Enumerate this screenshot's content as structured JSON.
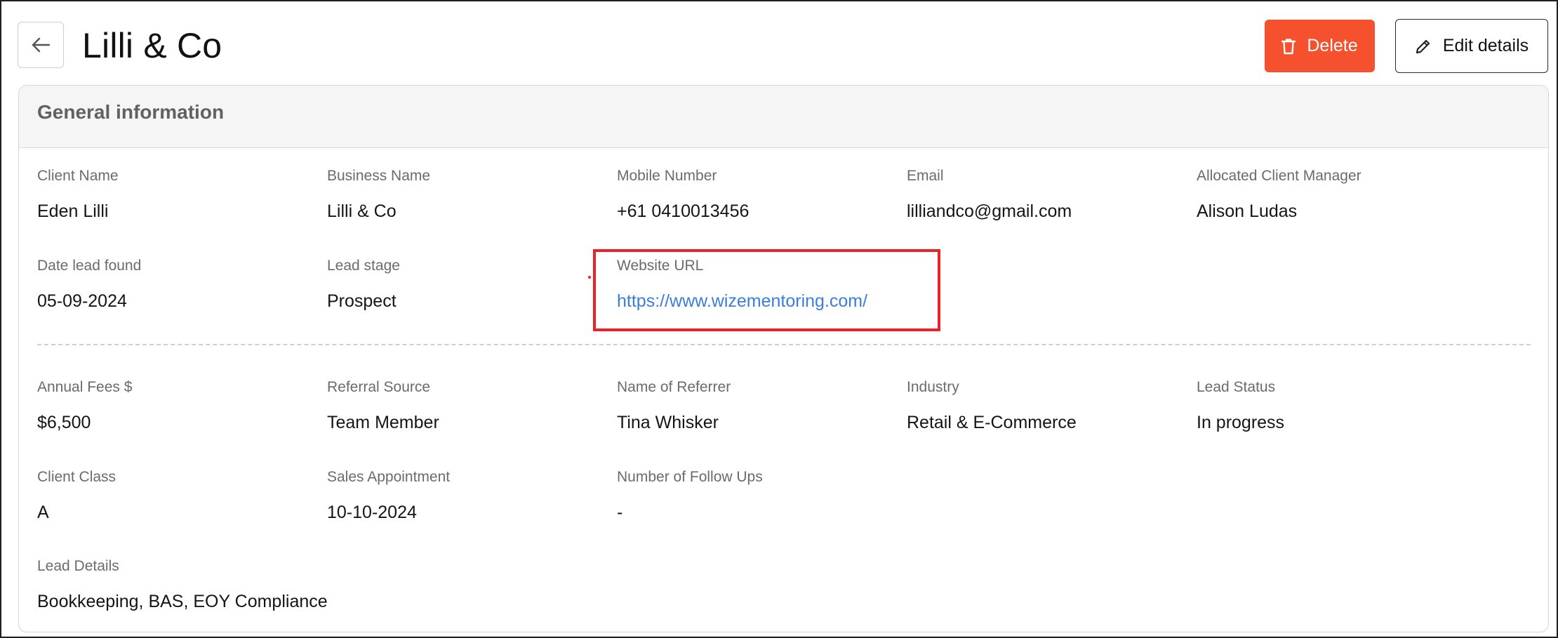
{
  "header": {
    "title": "Lilli & Co",
    "delete_label": "Delete",
    "edit_label": "Edit details"
  },
  "section": {
    "title": "General information"
  },
  "fields": {
    "client_name": {
      "label": "Client Name",
      "value": "Eden Lilli"
    },
    "business_name": {
      "label": "Business Name",
      "value": "Lilli & Co"
    },
    "mobile_number": {
      "label": "Mobile Number",
      "value": "+61 0410013456"
    },
    "email": {
      "label": "Email",
      "value": "lilliandco@gmail.com"
    },
    "allocated_client_manager": {
      "label": "Allocated Client Manager",
      "value": "Alison Ludas"
    },
    "date_lead_found": {
      "label": "Date lead found",
      "value": "05-09-2024"
    },
    "lead_stage": {
      "label": "Lead stage",
      "value": "Prospect"
    },
    "website_url": {
      "label": "Website URL",
      "value": "https://www.wizementoring.com/"
    },
    "annual_fees": {
      "label": "Annual Fees $",
      "value": "$6,500"
    },
    "referral_source": {
      "label": "Referral Source",
      "value": "Team Member"
    },
    "name_of_referrer": {
      "label": "Name of Referrer",
      "value": "Tina Whisker"
    },
    "industry": {
      "label": "Industry",
      "value": "Retail & E-Commerce"
    },
    "lead_status": {
      "label": "Lead Status",
      "value": "In progress"
    },
    "client_class": {
      "label": "Client Class",
      "value": "A"
    },
    "sales_appointment": {
      "label": "Sales Appointment",
      "value": "10-10-2024"
    },
    "number_of_follow_ups": {
      "label": "Number of Follow Ups",
      "value": "-"
    },
    "lead_details": {
      "label": "Lead Details",
      "value": "Bookkeeping, BAS, EOY Compliance"
    }
  },
  "icons": {
    "back": "arrow-left-icon",
    "delete": "trash-icon",
    "edit": "pencil-icon"
  },
  "colors": {
    "delete_button": "#f5512f",
    "link": "#3b7ddd",
    "highlight": "#e8232a"
  }
}
